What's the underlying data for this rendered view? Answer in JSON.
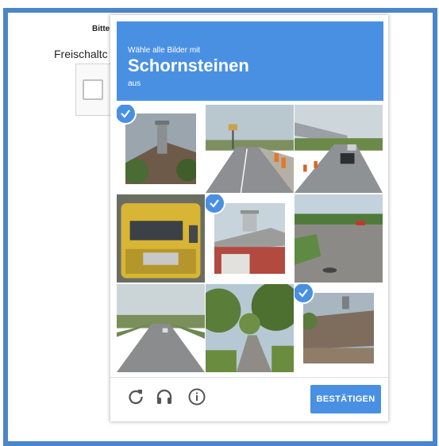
{
  "background": {
    "heading": "Bitte",
    "label": "Freischaltc"
  },
  "captcha": {
    "instruction_prefix": "Wähle alle Bilder mit",
    "target": "Schornsteinen",
    "instruction_suffix": "aus",
    "accent_color": "#4a90e2",
    "tiles": [
      {
        "subject": "house roof with chimney",
        "selected": true
      },
      {
        "subject": "road with traffic signs",
        "selected": false
      },
      {
        "subject": "street under overpass with cars",
        "selected": false
      },
      {
        "subject": "yellow truck",
        "selected": false
      },
      {
        "subject": "building roof with chimney",
        "selected": true
      },
      {
        "subject": "road intersection",
        "selected": false
      },
      {
        "subject": "highway",
        "selected": false
      },
      {
        "subject": "tree-lined street",
        "selected": false
      },
      {
        "subject": "roof with chimney",
        "selected": true
      }
    ],
    "footer": {
      "reload_icon": "reload-icon",
      "audio_icon": "headphones-icon",
      "info_icon": "info-icon",
      "verify_label": "BESTÄTIGEN"
    }
  }
}
